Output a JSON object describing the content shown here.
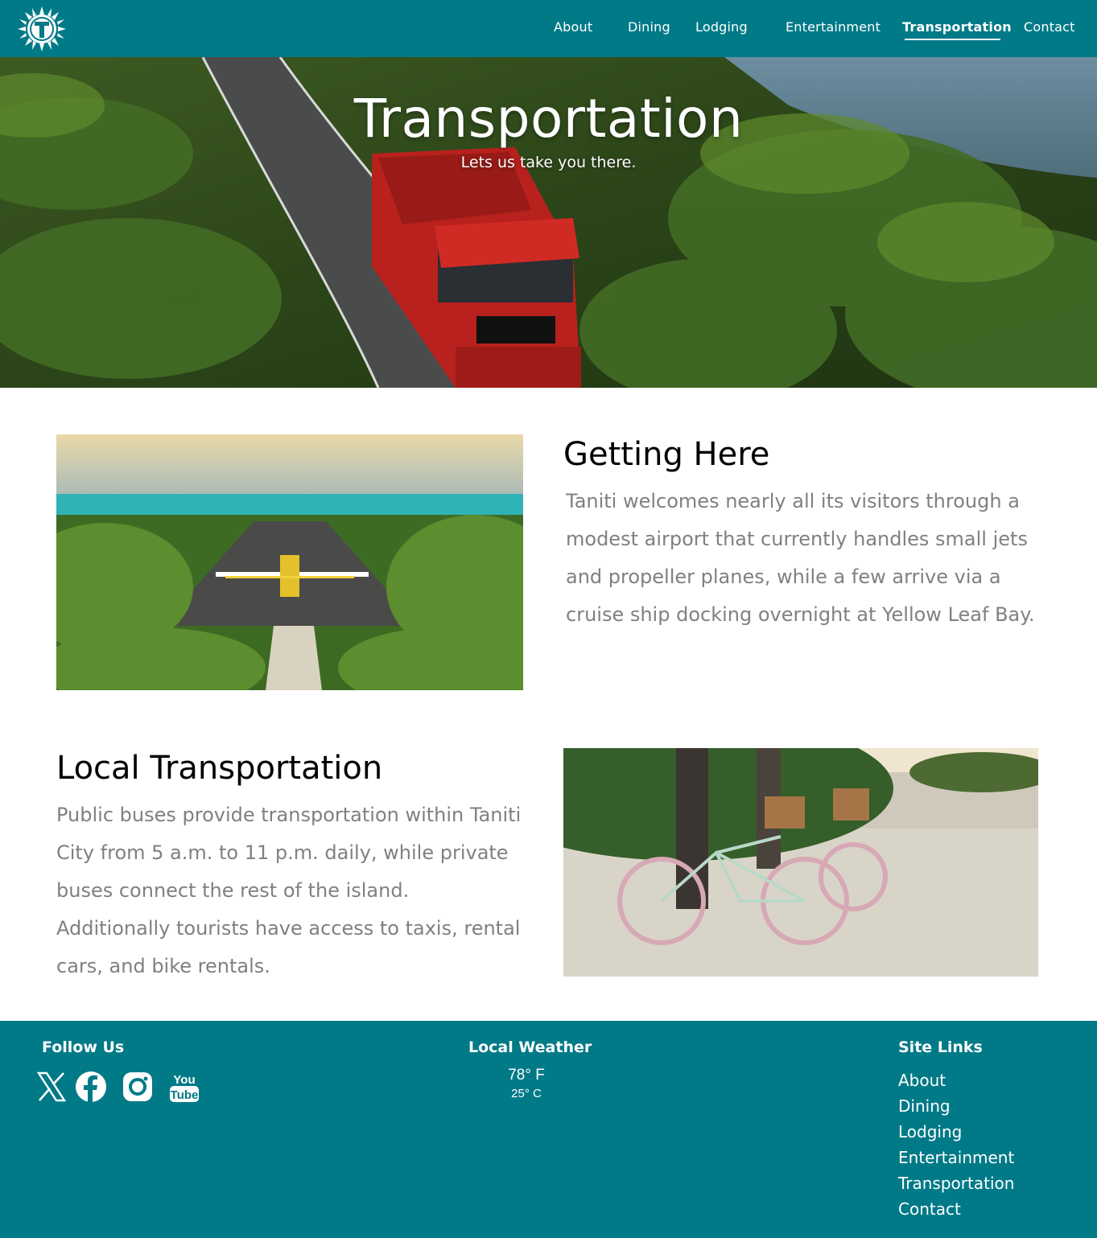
{
  "nav": {
    "logo_icon": "sun-t-logo-icon",
    "links": [
      "About",
      "Dining",
      "Lodging",
      "Entertainment",
      "Transportation",
      "Contact"
    ],
    "active": "Transportation"
  },
  "hero": {
    "title": "Transportation",
    "subtitle": "Lets us take you there.",
    "image": "red double-decker bus on palm-lined coastal road"
  },
  "sections": [
    {
      "title": "Getting Here",
      "text": "Taniti welcomes nearly all its visitors through a modest airport that currently handles small jets and propeller planes, while a few arrive via a cruise ship docking overnight at Yellow Leaf Bay.",
      "image": "small propeller plane on island runway"
    },
    {
      "title": "Local Transportation",
      "text": "Public buses provide transportation within Taniti City from 5 a.m. to 11 p.m. daily, while private buses connect the rest of the island. Additionally tourists have access to taxis, rental cars, and bike rentals.",
      "image": "bicycles with baskets on sandy beach"
    }
  ],
  "footer": {
    "follow": {
      "heading": "Follow Us",
      "icons": [
        "x-icon",
        "facebook-icon",
        "instagram-icon",
        "youtube-icon"
      ],
      "youtube_top": "You",
      "youtube_bottom": "Tube"
    },
    "weather": {
      "heading": "Local Weather",
      "fahrenheit": "78° F",
      "celsius": "25° C"
    },
    "site_links": {
      "heading": "Site Links",
      "links": [
        "About",
        "Dining",
        "Lodging",
        "Entertainment",
        "Transportation",
        "Contact"
      ]
    }
  },
  "colors": {
    "brand_teal": "#017a88",
    "body_text_gray": "#808080",
    "white": "#ffffff"
  }
}
